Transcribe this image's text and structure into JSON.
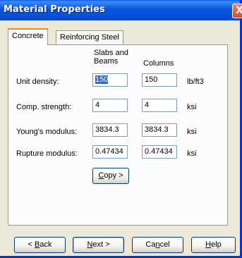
{
  "window": {
    "title": "Material Properties",
    "close_glyph": "X"
  },
  "tabs": [
    {
      "label": "Concrete",
      "active": true
    },
    {
      "label": "Reinforcing Steel",
      "active": false
    }
  ],
  "columns": {
    "slabs_line1": "Slabs and",
    "slabs_line2": "Beams",
    "columns": "Columns"
  },
  "rows": [
    {
      "label": "Unit density:",
      "slabs": "150",
      "columns": "150",
      "unit": "lb/ft3"
    },
    {
      "label": "Comp. strength:",
      "slabs": "4",
      "columns": "4",
      "unit": "ksi"
    },
    {
      "label": "Young's modulus:",
      "slabs": "3834.3",
      "columns": "3834.3",
      "unit": "ksi"
    },
    {
      "label": "Rupture modulus:",
      "slabs": "0.47434",
      "columns": "0.47434",
      "unit": "ksi"
    }
  ],
  "copy_button": {
    "mnemonic": "C",
    "rest": "opy >"
  },
  "footer": {
    "back": {
      "prefix": "< ",
      "mnemonic": "B",
      "rest": "ack"
    },
    "next": {
      "mnemonic": "N",
      "rest": "ext >"
    },
    "cancel": {
      "prefix": "Ca",
      "mnemonic": "n",
      "rest": "cel"
    },
    "help": {
      "mnemonic": "H",
      "rest": "elp"
    }
  }
}
